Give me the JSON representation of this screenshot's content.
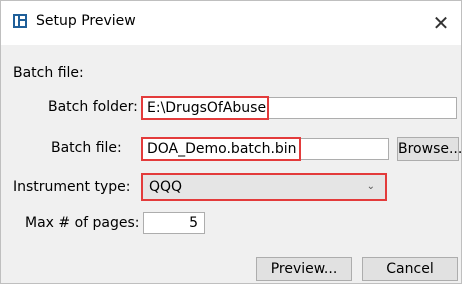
{
  "window": {
    "title": "Setup Preview",
    "close_glyph": "✕"
  },
  "batch_section": {
    "heading": "Batch file:"
  },
  "batch_folder": {
    "label": "Batch folder:",
    "value": "E:\\DrugsOfAbuse"
  },
  "batch_file": {
    "label": "Batch file:",
    "value": "DOA_Demo.batch.bin",
    "browse_label": "Browse..."
  },
  "instrument": {
    "label": "Instrument type:",
    "value": "QQQ"
  },
  "max_pages": {
    "label": "Max # of pages:",
    "value": "5"
  },
  "buttons": {
    "preview_label": "Preview...",
    "cancel_label": "Cancel"
  },
  "colors": {
    "highlight": "#e33b3b",
    "dialog_bg": "#f0f0f0",
    "icon": "#1f5f99"
  }
}
